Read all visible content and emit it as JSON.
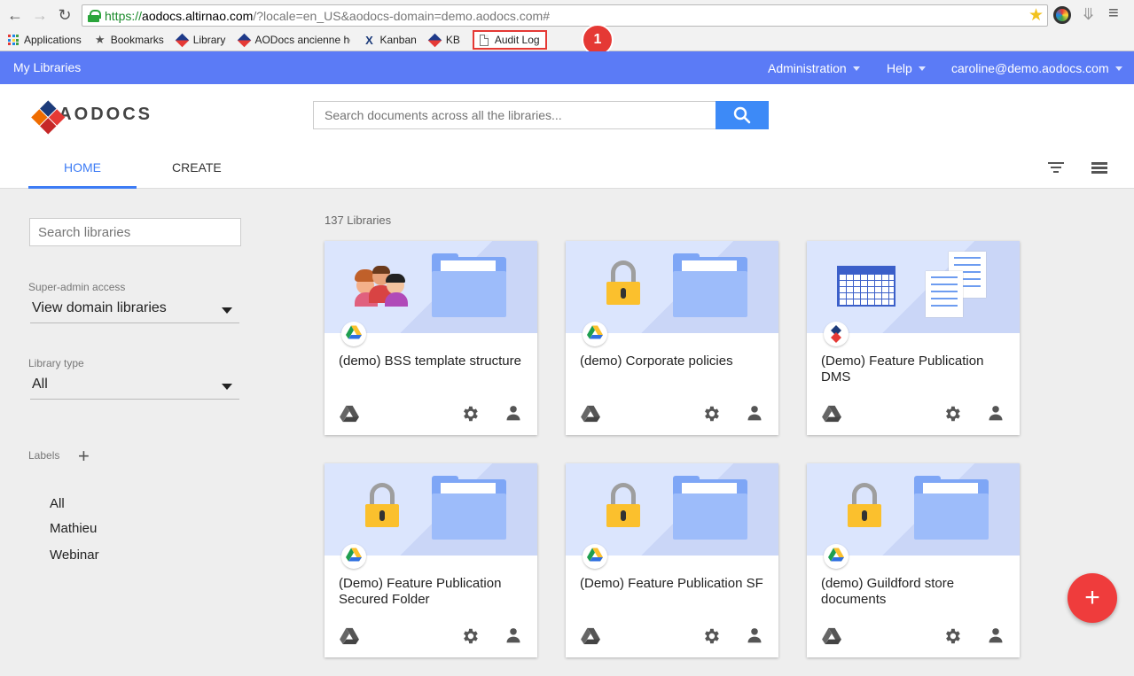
{
  "browser": {
    "url_scheme": "https://",
    "url_host": "aodocs.altirnao.com",
    "url_rest": "/?locale=en_US&aodocs-domain=demo.aodocs.com#",
    "bookmarks": [
      {
        "label": "Applications"
      },
      {
        "label": "Bookmarks"
      },
      {
        "label": "Library"
      },
      {
        "label": "AODocs ancienne ho"
      },
      {
        "label": "Kanban"
      },
      {
        "label": "KB"
      },
      {
        "label": "Audit Log"
      }
    ],
    "callout_number": "1"
  },
  "topbar": {
    "brand": "My Libraries",
    "administration": "Administration",
    "help": "Help",
    "user": "caroline@demo.aodocs.com"
  },
  "header": {
    "logo_text": "AODOCS",
    "search_placeholder": "Search documents across all the libraries...",
    "tabs": {
      "home": "HOME",
      "create": "CREATE"
    }
  },
  "sidebar": {
    "search_placeholder": "Search libraries",
    "super_admin_label": "Super-admin access",
    "super_admin_value": "View domain libraries",
    "library_type_label": "Library type",
    "library_type_value": "All",
    "labels_title": "Labels",
    "labels": [
      "All",
      "Mathieu",
      "Webinar"
    ]
  },
  "main": {
    "count": "137 Libraries",
    "cards": [
      {
        "title": "(demo) BSS template structure",
        "illustration": "people-icon",
        "badge": "google-drive-icon"
      },
      {
        "title": "(demo) Corporate policies",
        "illustration": "padlock-icon",
        "badge": "google-drive-icon"
      },
      {
        "title": "(Demo) Feature Publication DMS",
        "illustration": "spreadsheet-icon",
        "badge": "aodocs-icon"
      },
      {
        "title": "(Demo) Feature Publication Secured Folder",
        "illustration": "padlock-icon",
        "badge": "google-drive-icon"
      },
      {
        "title": "(Demo) Feature Publication SF",
        "illustration": "padlock-icon",
        "badge": "google-drive-icon"
      },
      {
        "title": "(demo) Guildford store documents",
        "illustration": "padlock-icon",
        "badge": "google-drive-icon"
      }
    ]
  },
  "fab": {
    "label": "+"
  },
  "colors": {
    "topbar": "#5b7bf6",
    "accent": "#3d7cf5",
    "fab": "#ef3c3c",
    "callout": "#e53935"
  }
}
